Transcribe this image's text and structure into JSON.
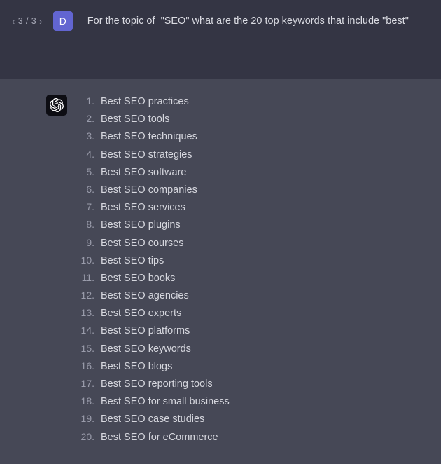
{
  "header": {
    "pager": {
      "prev_icon": "chevron-left-icon",
      "prev_glyph": "‹",
      "count_label": "3 / 3",
      "next_icon": "chevron-right-icon",
      "next_glyph": "›"
    },
    "user_avatar": {
      "initial": "D",
      "color": "#6265d1"
    },
    "prompt_text": "For the topic of  \"SEO\" what are the 20 top keywords that include \"best\"",
    "background_color": "#343544"
  },
  "answer": {
    "assistant_avatar": {
      "icon": "openai-logo-icon",
      "background_color": "#0d0d13"
    },
    "background_color": "#464856",
    "list": [
      {
        "num": "1",
        "label": "Best SEO practices"
      },
      {
        "num": "2",
        "label": "Best SEO tools"
      },
      {
        "num": "3",
        "label": "Best SEO techniques"
      },
      {
        "num": "4",
        "label": "Best SEO strategies"
      },
      {
        "num": "5",
        "label": "Best SEO software"
      },
      {
        "num": "6",
        "label": "Best SEO companies"
      },
      {
        "num": "7",
        "label": "Best SEO services"
      },
      {
        "num": "8",
        "label": "Best SEO plugins"
      },
      {
        "num": "9",
        "label": "Best SEO courses"
      },
      {
        "num": "10",
        "label": "Best SEO tips"
      },
      {
        "num": "11",
        "label": "Best SEO books"
      },
      {
        "num": "12",
        "label": "Best SEO agencies"
      },
      {
        "num": "13",
        "label": "Best SEO experts"
      },
      {
        "num": "14",
        "label": "Best SEO platforms"
      },
      {
        "num": "15",
        "label": "Best SEO keywords"
      },
      {
        "num": "16",
        "label": "Best SEO blogs"
      },
      {
        "num": "17",
        "label": "Best SEO reporting tools"
      },
      {
        "num": "18",
        "label": "Best SEO for small business"
      },
      {
        "num": "19",
        "label": "Best SEO case studies"
      },
      {
        "num": "20",
        "label": "Best SEO for eCommerce"
      }
    ]
  },
  "colors": {
    "text_primary": "#d6d7de",
    "text_muted": "#9a9cab",
    "accent": "#6265d1"
  }
}
